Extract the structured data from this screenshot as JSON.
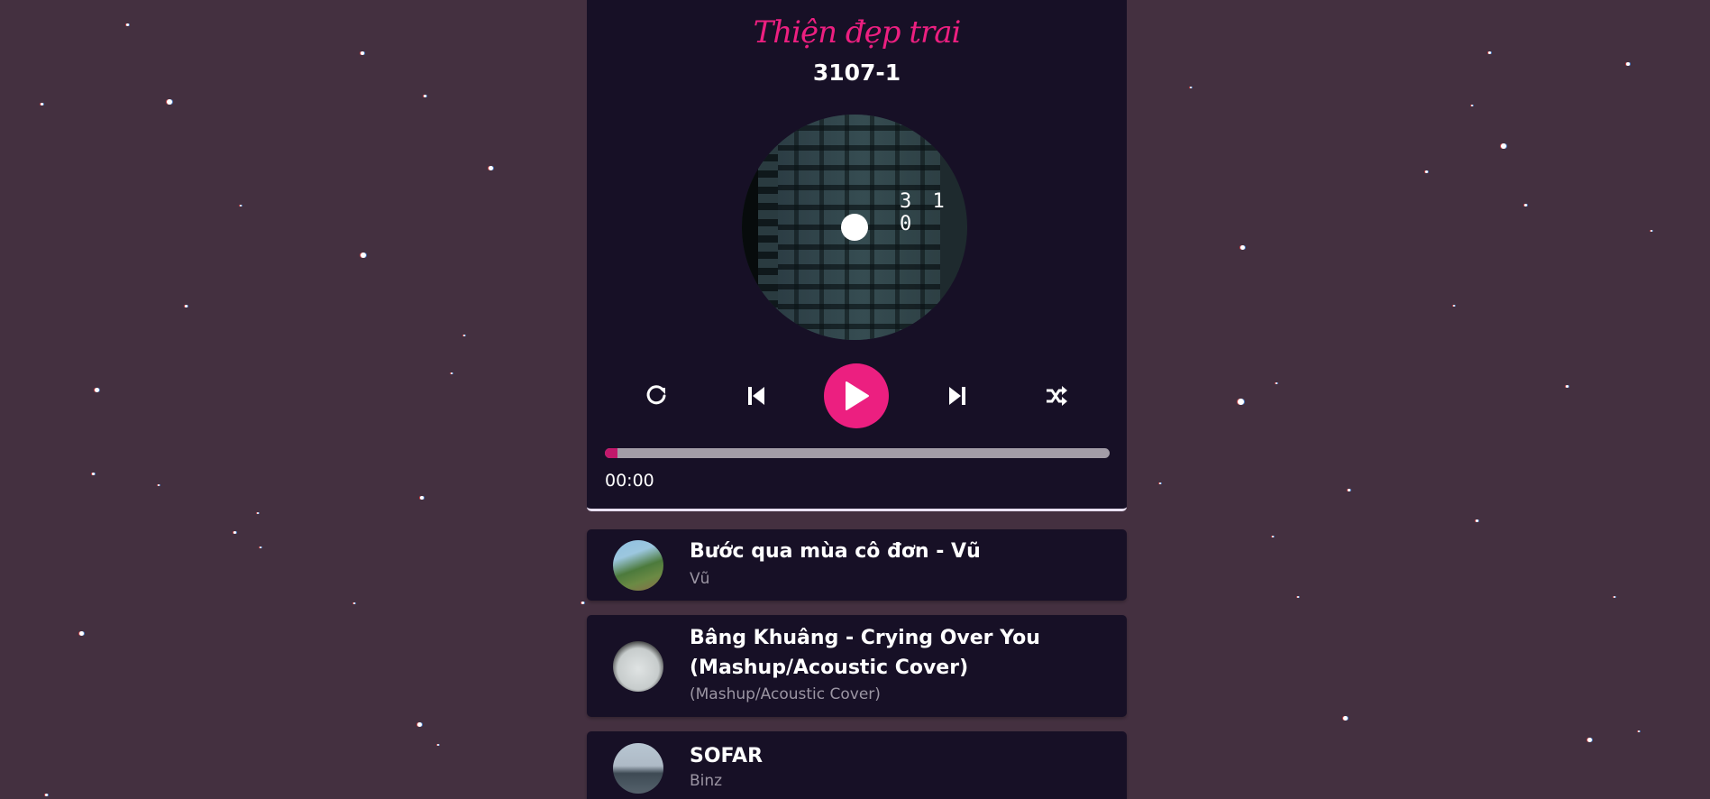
{
  "app": {
    "brand": "Thiện đẹp trai"
  },
  "now_playing": {
    "title": "3107-1",
    "cd_overlay_text": "3 1 0",
    "progress_fraction": 0.025,
    "current_time": "00:00"
  },
  "controls": {
    "repeat_icon": "repeat-icon",
    "prev_icon": "skip-back-icon",
    "play_icon": "play-icon",
    "next_icon": "skip-forward-icon",
    "shuffle_icon": "shuffle-icon"
  },
  "playlist": [
    {
      "title": "Bước qua mùa cô đơn - Vũ",
      "artist": "Vũ"
    },
    {
      "title": "Bâng Khuâng - Crying Over You (Mashup/Acoustic Cover)",
      "artist": "(Mashup/Acoustic Cover)"
    },
    {
      "title": "SOFAR",
      "artist": "Binz"
    }
  ],
  "colors": {
    "background": "#443040",
    "panel": "#171026",
    "accent": "#ec1f80",
    "progress_fill": "#c2186b",
    "progress_track": "#a39da7"
  }
}
